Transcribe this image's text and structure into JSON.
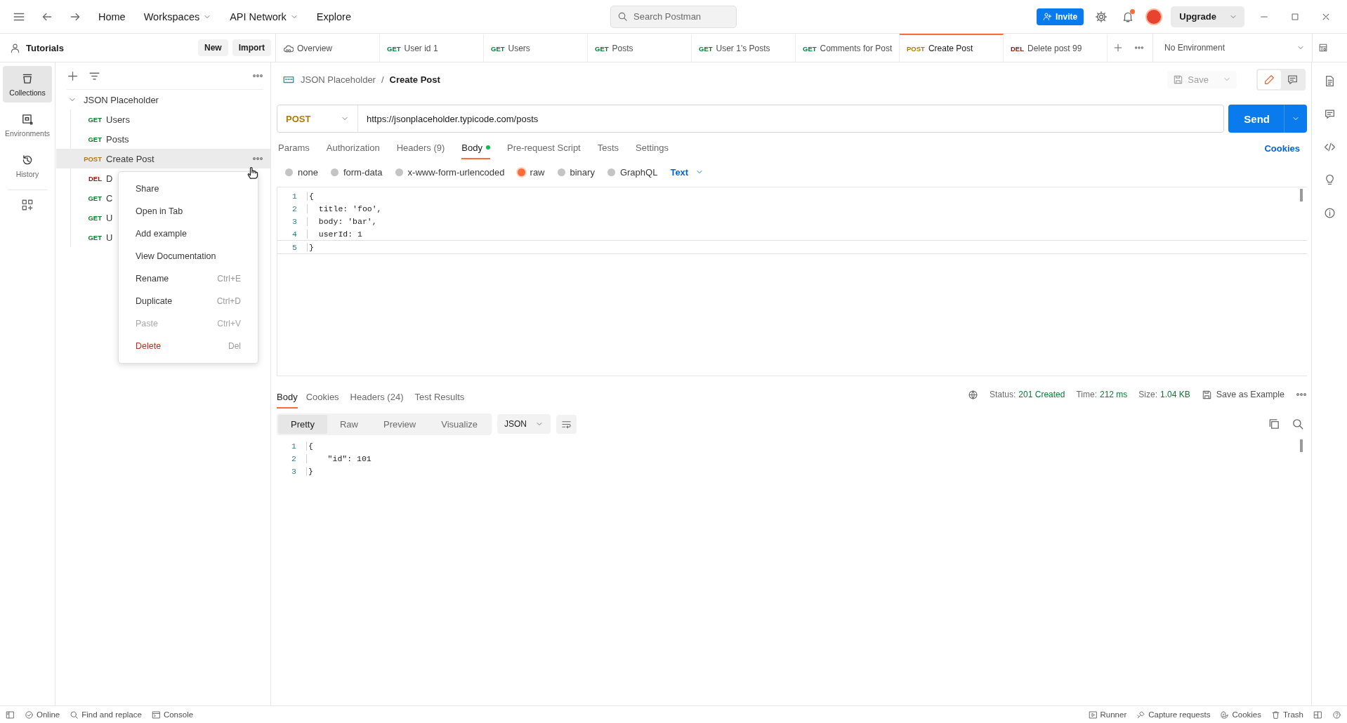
{
  "topbar": {
    "nav": [
      {
        "label": "Home",
        "dropdown": false
      },
      {
        "label": "Workspaces",
        "dropdown": true
      },
      {
        "label": "API Network",
        "dropdown": true
      },
      {
        "label": "Explore",
        "dropdown": false
      }
    ],
    "search": {
      "placeholder": "Search Postman"
    },
    "invite": "Invite",
    "notification_dot": true,
    "upgrade": "Upgrade"
  },
  "workspace": {
    "title": "Tutorials",
    "buttons": [
      "New",
      "Import"
    ]
  },
  "tabs": [
    {
      "kind": "overview",
      "label": "Overview",
      "selected": false
    },
    {
      "kind": "request",
      "method": "GET",
      "label": "User id 1",
      "selected": false
    },
    {
      "kind": "request",
      "method": "GET",
      "label": "Users",
      "selected": false
    },
    {
      "kind": "request",
      "method": "GET",
      "label": "Posts",
      "selected": false
    },
    {
      "kind": "request",
      "method": "GET",
      "label": "User 1's Posts",
      "selected": false
    },
    {
      "kind": "request",
      "method": "GET",
      "label": "Comments for Post",
      "selected": false
    },
    {
      "kind": "request",
      "method": "POST",
      "label": "Create Post",
      "selected": true
    },
    {
      "kind": "request",
      "method": "DEL",
      "label": "Delete post 99",
      "selected": false
    }
  ],
  "environment": "No Environment",
  "rail": [
    {
      "kind": "collections",
      "label": "Collections",
      "selected": true
    },
    {
      "kind": "environments",
      "label": "Environments",
      "selected": false
    },
    {
      "kind": "history",
      "label": "History",
      "selected": false
    }
  ],
  "collection": {
    "name": "JSON Placeholder",
    "expanded": true,
    "children": [
      {
        "method": "GET",
        "name": "Users",
        "hovered": false
      },
      {
        "method": "GET",
        "name": "Posts",
        "hovered": false
      },
      {
        "method": "POST",
        "name": "Create Post",
        "hovered": true
      },
      {
        "method": "DEL",
        "name": "D",
        "hovered": false
      },
      {
        "method": "GET",
        "name": "C",
        "hovered": false
      },
      {
        "method": "GET",
        "name": "U",
        "hovered": false
      },
      {
        "method": "GET",
        "name": "U",
        "hovered": false
      }
    ]
  },
  "context_menu": {
    "items": [
      {
        "kind": "normal",
        "label": "Share",
        "disabled": false
      },
      {
        "kind": "normal",
        "label": "Open in Tab",
        "disabled": false
      },
      {
        "kind": "normal",
        "label": "Add example",
        "disabled": false
      },
      {
        "kind": "normal",
        "label": "View Documentation",
        "disabled": false
      },
      {
        "kind": "normal",
        "label": "Rename",
        "shortcut": "Ctrl+E",
        "disabled": false
      },
      {
        "kind": "normal",
        "label": "Duplicate",
        "shortcut": "Ctrl+D",
        "disabled": false
      },
      {
        "kind": "normal",
        "label": "Paste",
        "shortcut": "Ctrl+V",
        "disabled": true
      },
      {
        "kind": "danger",
        "label": "Delete",
        "shortcut": "Del",
        "disabled": false
      }
    ]
  },
  "request": {
    "breadcrumb": [
      "JSON Placeholder",
      "/",
      "Create Post"
    ],
    "save": "Save",
    "method": "POST",
    "url": "https://jsonplaceholder.typicode.com/posts",
    "send": "Send",
    "tabs": [
      {
        "label": "Params",
        "selected": false,
        "dot": false
      },
      {
        "label": "Authorization",
        "selected": false,
        "dot": false
      },
      {
        "label": "Headers (9)",
        "selected": false,
        "dot": false
      },
      {
        "label": "Body",
        "selected": true,
        "dot": true
      },
      {
        "label": "Pre-request Script",
        "selected": false,
        "dot": false
      },
      {
        "label": "Tests",
        "selected": false,
        "dot": false
      },
      {
        "label": "Settings",
        "selected": false,
        "dot": false
      }
    ],
    "cookies": "Cookies",
    "body_modes": [
      {
        "label": "none",
        "selected": false
      },
      {
        "label": "form-data",
        "selected": false
      },
      {
        "label": "x-www-form-urlencoded",
        "selected": false
      },
      {
        "label": "raw",
        "selected": true
      },
      {
        "label": "binary",
        "selected": false
      },
      {
        "label": "GraphQL",
        "selected": false
      }
    ],
    "format": "Text",
    "lines": [
      {
        "n": "1",
        "text": "{"
      },
      {
        "n": "2",
        "text": "  title: 'foo',"
      },
      {
        "n": "3",
        "text": "  body: 'bar',"
      },
      {
        "n": "4",
        "text": "  userId: 1"
      },
      {
        "n": "5",
        "text": "}"
      }
    ]
  },
  "response": {
    "tabs": [
      {
        "label": "Body",
        "selected": true
      },
      {
        "label": "Cookies",
        "selected": false
      },
      {
        "label": "Headers (24)",
        "selected": false
      },
      {
        "label": "Test Results",
        "selected": false
      }
    ],
    "stats": [
      {
        "label": "Status:",
        "value": "201 Created"
      },
      {
        "label": "Time:",
        "value": "212 ms"
      },
      {
        "label": "Size:",
        "value": "1.04 KB"
      }
    ],
    "save_example": "Save as Example",
    "views": [
      {
        "label": "Pretty",
        "selected": true
      },
      {
        "label": "Raw",
        "selected": false
      },
      {
        "label": "Preview",
        "selected": false
      },
      {
        "label": "Visualize",
        "selected": false
      }
    ],
    "language": "JSON",
    "lines": [
      {
        "n": "1",
        "text": "{"
      },
      {
        "n": "2",
        "text": "    \"id\": 101"
      },
      {
        "n": "3",
        "text": "}"
      }
    ]
  },
  "status_bar": {
    "left": [
      {
        "kind": "online",
        "label": "Online"
      },
      {
        "kind": "find",
        "label": "Find and replace"
      },
      {
        "kind": "console",
        "label": "Console"
      }
    ],
    "right": [
      {
        "kind": "runner",
        "label": "Runner"
      },
      {
        "kind": "capture",
        "label": "Capture requests"
      },
      {
        "kind": "cookies",
        "label": "Cookies"
      },
      {
        "kind": "trash",
        "label": "Trash"
      }
    ]
  }
}
